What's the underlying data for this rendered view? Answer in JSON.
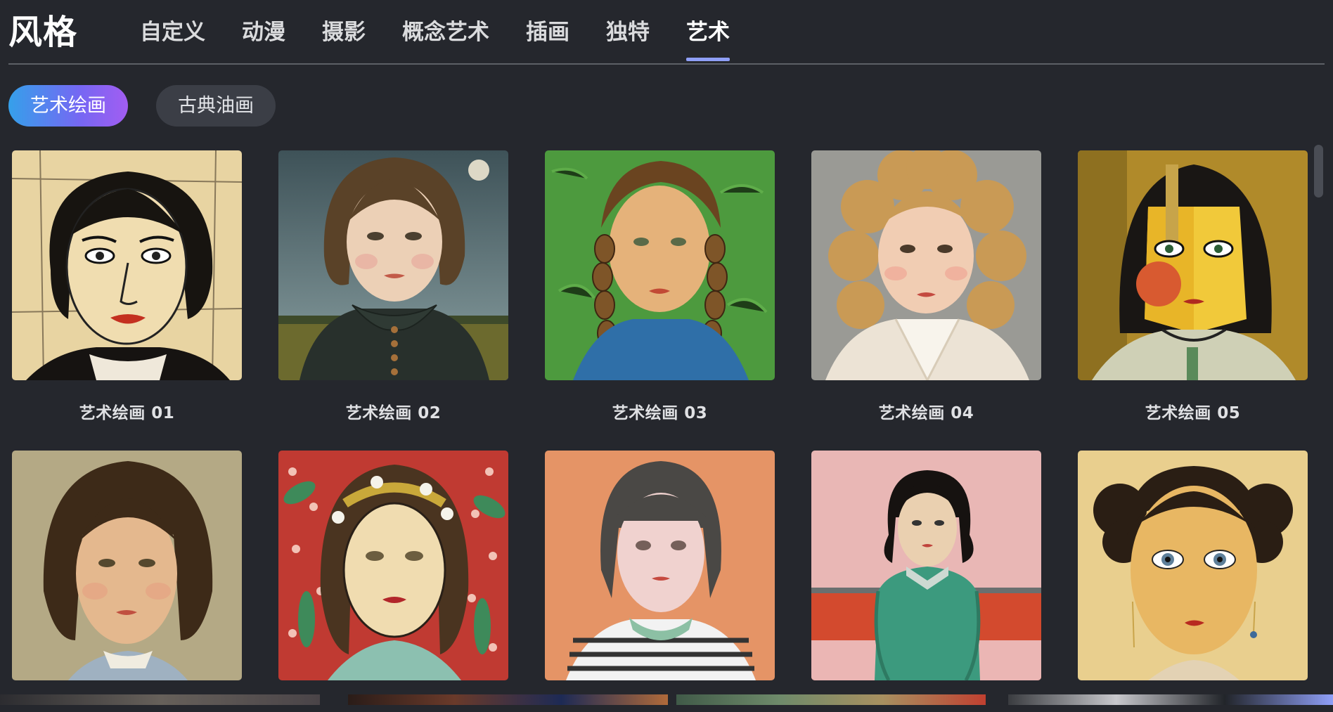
{
  "header": {
    "title": "风格",
    "tabs": [
      {
        "label": "自定义"
      },
      {
        "label": "动漫"
      },
      {
        "label": "摄影"
      },
      {
        "label": "概念艺术"
      },
      {
        "label": "插画"
      },
      {
        "label": "独特"
      },
      {
        "label": "艺术"
      }
    ],
    "active_tab": "艺术"
  },
  "subtabs": {
    "items": [
      {
        "label": "艺术绘画",
        "active": true
      },
      {
        "label": "古典油画",
        "active": false
      }
    ]
  },
  "cards": [
    {
      "label": "艺术绘画 01",
      "thumb": "portrait-ink-woodcut-icon"
    },
    {
      "label": "艺术绘画 02",
      "thumb": "portrait-surreal-girl-moon-icon"
    },
    {
      "label": "艺术绘画 03",
      "thumb": "portrait-impressionist-braids-icon"
    },
    {
      "label": "艺术绘画 04",
      "thumb": "portrait-curly-girl-oil-icon"
    },
    {
      "label": "艺术绘画 05",
      "thumb": "portrait-cubist-face-icon"
    },
    {
      "label": "",
      "thumb": "portrait-classic-wavy-hair-icon"
    },
    {
      "label": "",
      "thumb": "portrait-floral-nouveau-icon"
    },
    {
      "label": "",
      "thumb": "portrait-bob-striped-shirt-icon"
    },
    {
      "label": "",
      "thumb": "portrait-pink-room-green-sweater-icon"
    },
    {
      "label": "",
      "thumb": "portrait-big-eyes-buns-icon"
    }
  ],
  "colors": {
    "background": "#25272d",
    "accent_underline": "#8f9ff8",
    "pill_gradient_start": "#35a0ea",
    "pill_gradient_end": "#a25df1",
    "pill_inactive": "#3b3e46"
  }
}
